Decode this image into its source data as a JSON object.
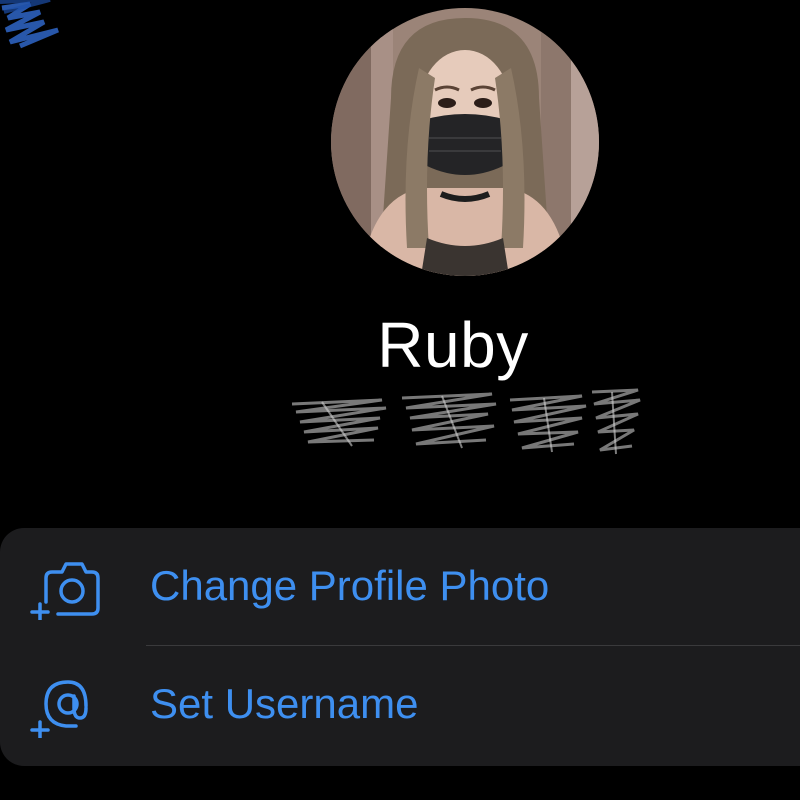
{
  "profile": {
    "name": "Ruby",
    "phone_redacted": true
  },
  "actions": [
    {
      "label": "Change Profile Photo",
      "icon": "add-camera-icon"
    },
    {
      "label": "Set Username",
      "icon": "add-at-sign-icon"
    }
  ],
  "colors": {
    "background": "#000000",
    "card": "#1c1c1e",
    "accent": "#3e8ff0",
    "divider": "#3a3a3c",
    "name_text": "#ffffff"
  }
}
